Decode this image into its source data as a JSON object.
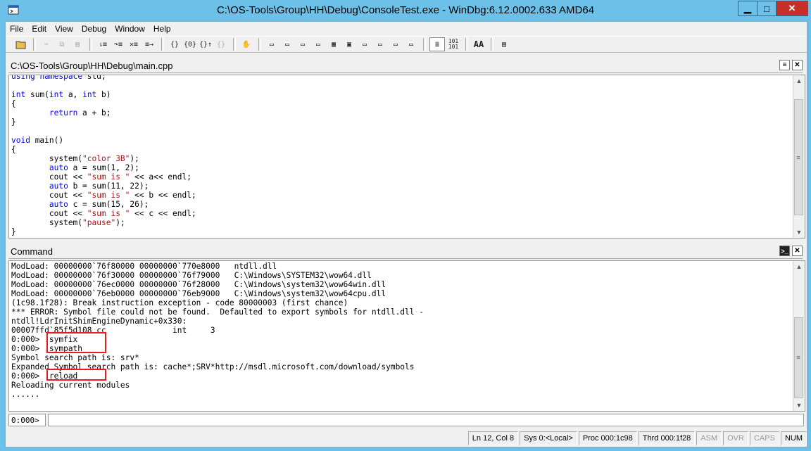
{
  "window": {
    "title": "C:\\OS-Tools\\Group\\HH\\Debug\\ConsoleTest.exe - WinDbg:6.12.0002.633 AMD64",
    "minimize_glyph": "▁",
    "maximize_glyph": "□",
    "close_glyph": "✕"
  },
  "menu": [
    "File",
    "Edit",
    "View",
    "Debug",
    "Window",
    "Help"
  ],
  "toolbar_icons": [
    "open-icon",
    "cut-icon",
    "copy-icon",
    "paste-icon",
    "step-into-icon",
    "step-over-icon",
    "step-out-icon",
    "run-to-cursor-icon",
    "braces-go-icon",
    "braces-step-icon",
    "braces-out-icon",
    "braces-disabled-icon",
    "hand-icon",
    "command-window-icon",
    "watch-icon",
    "locals-icon",
    "registers-icon",
    "memory-icon",
    "call-stack-icon",
    "disassembly-icon",
    "scratchpad-icon",
    "source-mode-icon",
    "hex-icon",
    "font-icon",
    "options-icon"
  ],
  "source_pane": {
    "title": "C:\\OS-Tools\\Group\\HH\\Debug\\main.cpp",
    "lines": [
      "using namespace std;",
      "",
      "int sum(int a, int b)",
      "{",
      "        return a + b;",
      "}",
      "",
      "void main()",
      "{",
      "        system(\"color 3B\");",
      "        auto a = sum(1, 2);",
      "        cout << \"sum is \" << a<< endl;",
      "        auto b = sum(11, 22);",
      "        cout << \"sum is \" << b << endl;",
      "        auto c = sum(15, 26);",
      "        cout << \"sum is \" << c << endl;",
      "        system(\"pause\");",
      "}"
    ]
  },
  "command_pane": {
    "title": "Command",
    "lines": [
      "ModLoad: 00000000`76f80000 00000000`770e8000   ntdll.dll",
      "ModLoad: 00000000`76f30000 00000000`76f79000   C:\\Windows\\SYSTEM32\\wow64.dll",
      "ModLoad: 00000000`76ec0000 00000000`76f28000   C:\\Windows\\system32\\wow64win.dll",
      "ModLoad: 00000000`76eb0000 00000000`76eb9000   C:\\Windows\\system32\\wow64cpu.dll",
      "(1c98.1f28): Break instruction exception - code 80000003 (first chance)",
      "*** ERROR: Symbol file could not be found.  Defaulted to export symbols for ntdll.dll -",
      "ntdll!LdrInitShimEngineDynamic+0x330:",
      "00007ffd`85f5d108 cc              int     3",
      "0:000> .symfix",
      "0:000> .sympath",
      "Symbol search path is: srv*",
      "Expanded Symbol search path is: cache*;SRV*http://msdl.microsoft.com/download/symbols",
      "0:000> .reload",
      "Reloading current modules",
      "......"
    ],
    "prompt": "0:000>",
    "input_value": ""
  },
  "status": {
    "position": "Ln 12, Col 8",
    "sys": "Sys 0:<Local>",
    "proc": "Proc 000:1c98",
    "thrd": "Thrd 000:1f28",
    "asm": "ASM",
    "ovr": "OVR",
    "caps": "CAPS",
    "num": "NUM"
  },
  "colors": {
    "titlebar": "#6dc0e8",
    "close_button": "#c7302a",
    "highlight_box": "#e81c1c",
    "keyword": "#0000ff",
    "string": "#a31515"
  }
}
